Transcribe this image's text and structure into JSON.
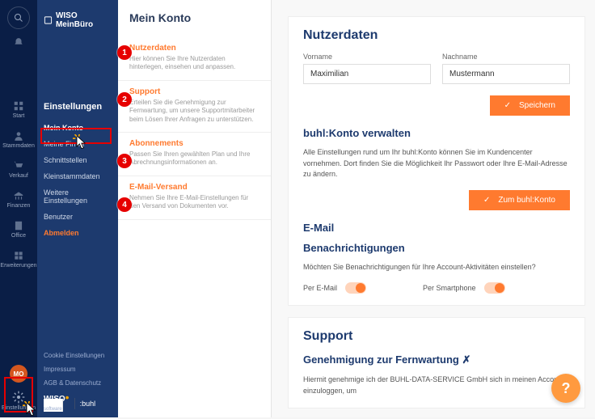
{
  "brand": "WISO MeinBüro",
  "rail": {
    "items": [
      {
        "label": "Start"
      },
      {
        "label": "Stammdaten"
      },
      {
        "label": "Verkauf"
      },
      {
        "label": "Finanzen"
      },
      {
        "label": "Office"
      },
      {
        "label": "Erweiterungen"
      }
    ],
    "avatar": "MO",
    "settings": "Einstellungen"
  },
  "side": {
    "title": "Einstellungen",
    "items": [
      {
        "label": "Mein Konto",
        "active": true
      },
      {
        "label": "Meine Firma"
      },
      {
        "label": "Schnittstellen"
      },
      {
        "label": "Kleinstammdaten"
      },
      {
        "label": "Weitere Einstellungen"
      },
      {
        "label": "Benutzer"
      },
      {
        "label": "Abmelden",
        "warn": true
      }
    ],
    "footer": [
      "Cookie Einstellungen",
      "Impressum",
      "AGB & Datenschutz"
    ],
    "logo_main": "WISO",
    "logo_sub": "software",
    "logo_buhl": ":buhl"
  },
  "sub": {
    "title": "Mein Konto",
    "items": [
      {
        "h": "Nutzerdaten",
        "d": "Hier können Sie Ihre Nutzerdaten hinterlegen, einsehen und anpassen."
      },
      {
        "h": "Support",
        "d": "Erteilen Sie die Genehmigung zur Fernwartung, um unsere Supportmitarbeiter beim Lösen Ihrer Anfragen zu unterstützen."
      },
      {
        "h": "Abonnements",
        "d": "Passen Sie Ihren gewählten Plan und Ihre Abrechnungsinformationen an."
      },
      {
        "h": "E-Mail-Versand",
        "d": "Nehmen Sie Ihre E-Mail-Einstellungen für den Versand von Dokumenten vor."
      }
    ]
  },
  "main": {
    "h1": "Nutzerdaten",
    "vorname_label": "Vorname",
    "vorname": "Maximilian",
    "nachname_label": "Nachname",
    "nachname": "Mustermann",
    "save": "Speichern",
    "h2": "buhl:Konto verwalten",
    "h2_desc": "Alle Einstellungen rund um Ihr buhl:Konto können Sie im Kundencenter vornehmen. Dort finden Sie die Möglichkeit Ihr Passwort oder Ihre E-Mail-Adresse zu ändern.",
    "btn2": "Zum buhl:Konto",
    "h3": "E-Mail",
    "h4": "Benachrichtigungen",
    "h4_desc": "Möchten Sie Benachrichtigungen für Ihre Account-Aktivitäten einstellen?",
    "tog1": "Per E-Mail",
    "tog2": "Per Smartphone",
    "support_h": "Support",
    "support_sub": "Genehmigung zur Fernwartung ✗",
    "support_desc": "Hiermit genehmige ich der BUHL-DATA-SERVICE GmbH sich in meinen Account einzuloggen, um"
  },
  "markers": [
    "1",
    "2",
    "3",
    "4"
  ]
}
